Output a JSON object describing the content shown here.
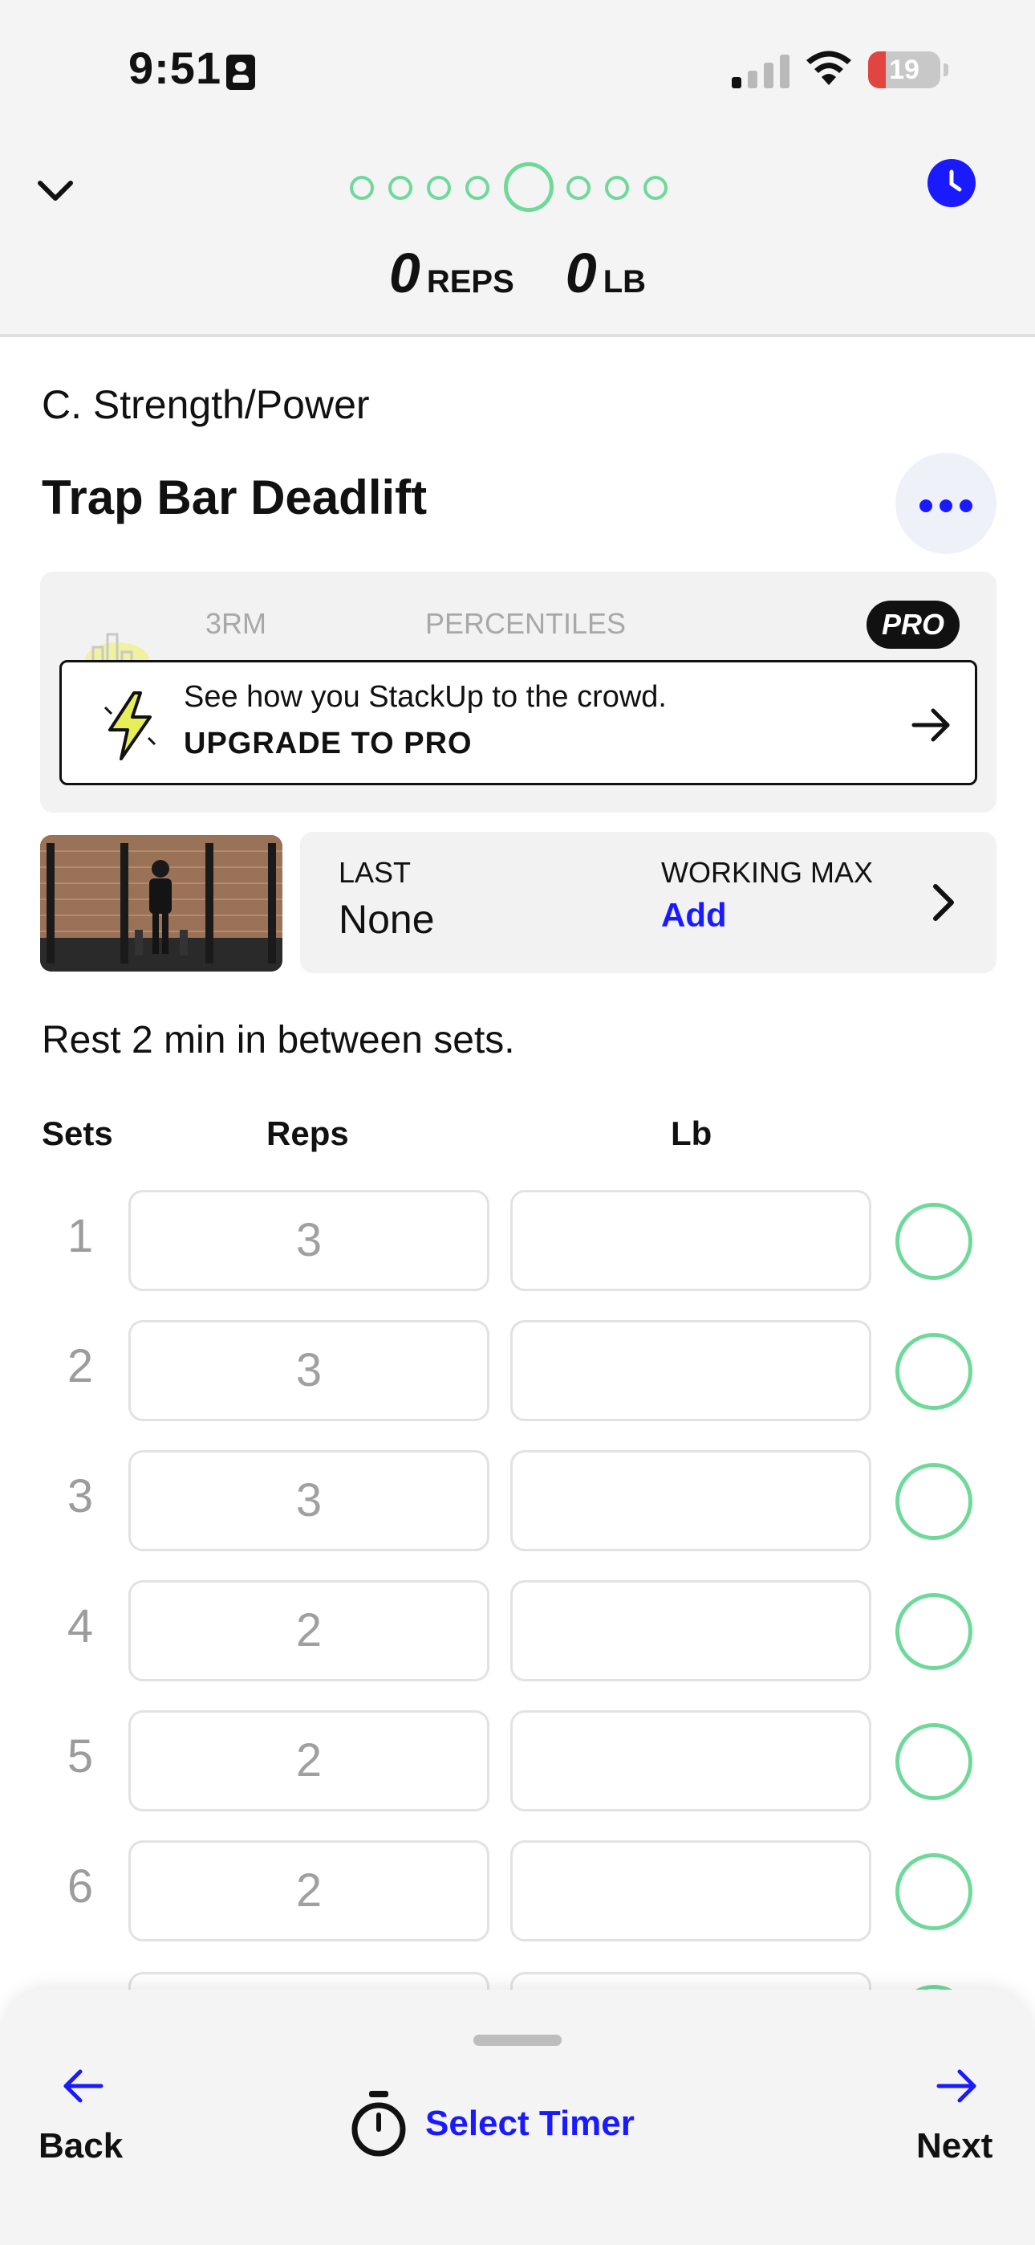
{
  "status_bar": {
    "time": "9:51",
    "battery": "19"
  },
  "header": {
    "reps_value": "0",
    "reps_unit": "REPS",
    "weight_value": "0",
    "weight_unit": "LB",
    "progress": {
      "total_dots": 8,
      "current_index": 4
    }
  },
  "exercise": {
    "section": "C. Strength/Power",
    "title": "Trap Bar Deadlift"
  },
  "pro_card": {
    "tabs": [
      "3RM",
      "PERCENTILES"
    ],
    "badge": "PRO",
    "message": "See how you StackUp to the crowd.",
    "cta": "UPGRADE TO PRO"
  },
  "info": {
    "last_label": "LAST",
    "last_value": "None",
    "working_max_label": "WORKING MAX",
    "working_max_value": "Add"
  },
  "rest_note": "Rest 2 min in between sets.",
  "table": {
    "columns": [
      "Sets",
      "Reps",
      "Lb"
    ],
    "rows": [
      {
        "set": "1",
        "reps": "3",
        "lb": ""
      },
      {
        "set": "2",
        "reps": "3",
        "lb": ""
      },
      {
        "set": "3",
        "reps": "3",
        "lb": ""
      },
      {
        "set": "4",
        "reps": "2",
        "lb": ""
      },
      {
        "set": "5",
        "reps": "2",
        "lb": ""
      },
      {
        "set": "6",
        "reps": "2",
        "lb": ""
      }
    ]
  },
  "bottom_bar": {
    "back": "Back",
    "timer": "Select Timer",
    "next": "Next"
  },
  "colors": {
    "accent_blue": "#1a1aff",
    "accent_green": "#6fd99a"
  }
}
